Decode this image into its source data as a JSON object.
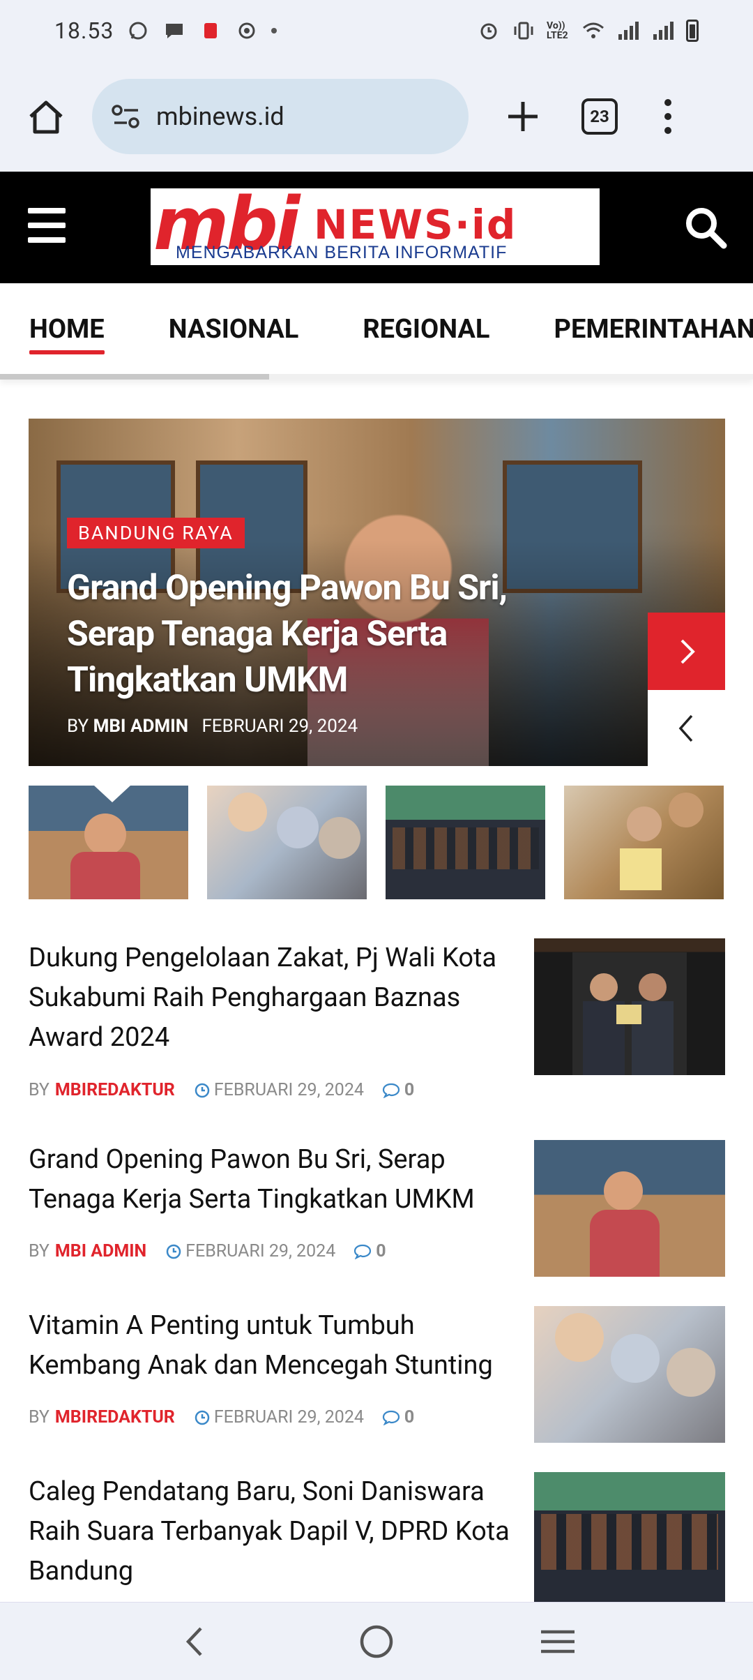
{
  "statusbar": {
    "time": "18.53",
    "network_label": "Vo)) LTE2"
  },
  "browser": {
    "url": "mbinews.id",
    "tab_count": "23"
  },
  "site": {
    "logo_main": "mbi",
    "logo_news": "NEWS·id",
    "logo_tagline": "MENGABARKAN BERITA INFORMATIF"
  },
  "nav": {
    "items": [
      "HOME",
      "NASIONAL",
      "REGIONAL",
      "PEMERINTAHAN"
    ]
  },
  "hero": {
    "category": "BANDUNG RAYA",
    "title": "Grand Opening Pawon Bu Sri, Serap Tenaga Kerja Serta Tingkatkan UMKM",
    "by": "BY",
    "author": "MBI ADMIN",
    "date": "FEBRUARI 29, 2024"
  },
  "articles": [
    {
      "title": "Dukung Pengelolaan Zakat, Pj Wali Kota Sukabumi Raih Penghargaan Baznas Award 2024",
      "by": "BY",
      "author": "MBIREDAKTUR",
      "date": "FEBRUARI 29, 2024",
      "comments": "0"
    },
    {
      "title": "Grand Opening Pawon Bu Sri, Serap Tenaga Kerja Serta Tingkatkan UMKM",
      "by": "BY",
      "author": "MBI ADMIN",
      "date": "FEBRUARI 29, 2024",
      "comments": "0"
    },
    {
      "title": "Vitamin A Penting untuk Tumbuh Kembang Anak dan Mencegah Stunting",
      "by": "BY",
      "author": "MBIREDAKTUR",
      "date": "FEBRUARI 29, 2024",
      "comments": "0"
    },
    {
      "title": "Caleg Pendatang Baru, Soni Daniswara Raih Suara Terbanyak Dapil V, DPRD Kota Bandung",
      "by": "BY",
      "author": "",
      "date": "",
      "comments": ""
    }
  ],
  "colors": {
    "accent": "#e0242c",
    "comment_icon": "#3a88c8",
    "header_bg": "#000000"
  }
}
